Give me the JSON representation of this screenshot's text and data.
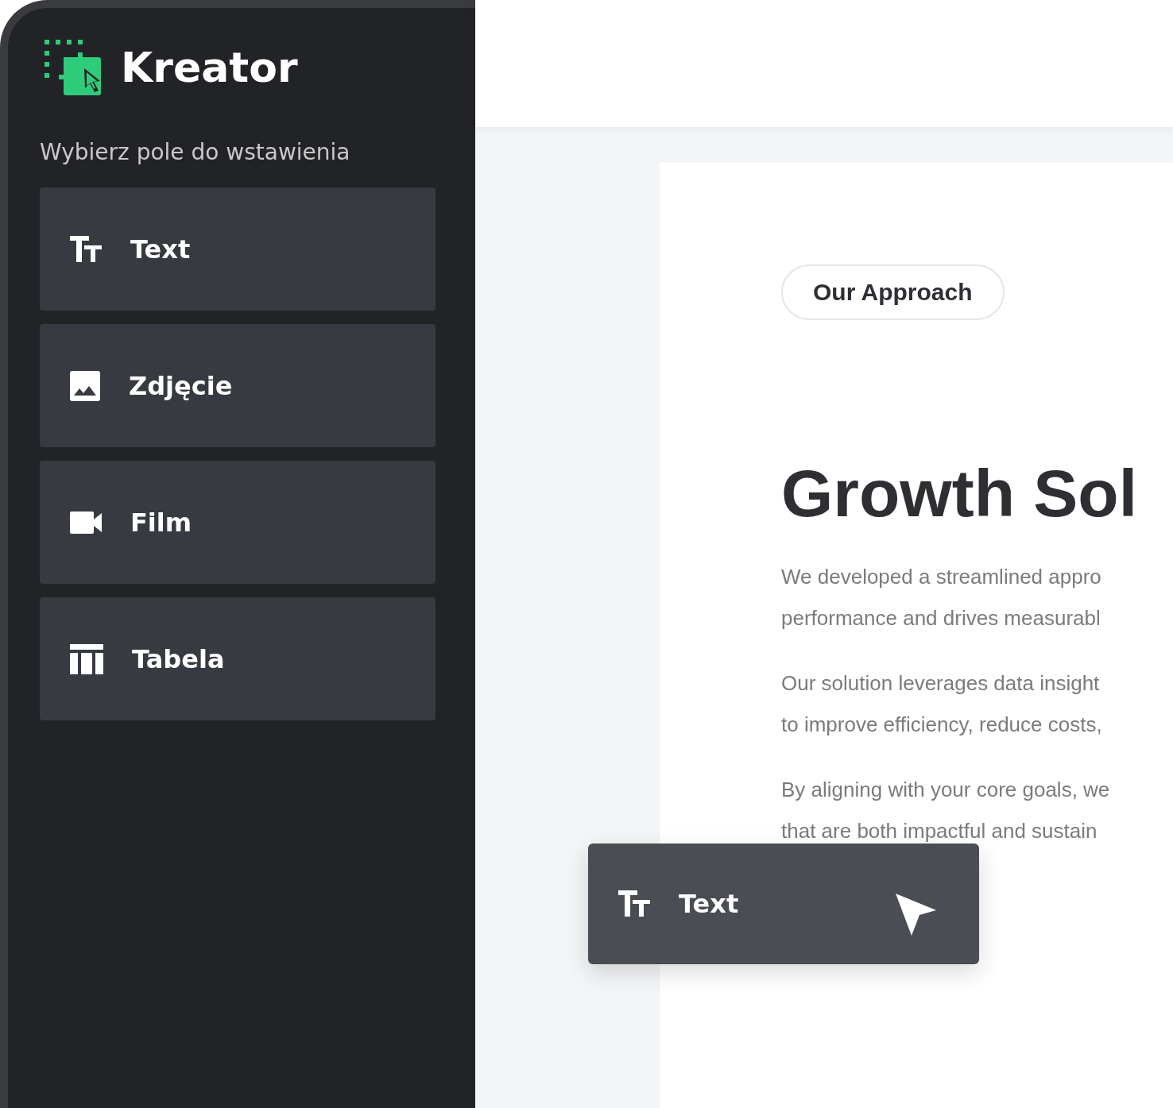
{
  "sidebar": {
    "logo": "Kreator",
    "subtitle": "Wybierz pole do wstawienia",
    "items": [
      {
        "kind": "text",
        "label": "Text"
      },
      {
        "kind": "image",
        "label": "Zdjęcie"
      },
      {
        "kind": "video",
        "label": "Film"
      },
      {
        "kind": "table",
        "label": "Tabela"
      }
    ]
  },
  "content": {
    "badge": "Our Approach",
    "heading": "Growth Sol",
    "paragraphs": [
      {
        "lines": [
          "We developed a streamlined appro",
          "performance and drives measurabl"
        ]
      },
      {
        "lines": [
          "Our solution leverages data insight",
          "to improve efficiency, reduce costs,"
        ]
      },
      {
        "lines": [
          "By aligning with your core goals, we",
          "that are both impactful and sustain"
        ]
      }
    ]
  },
  "drag_item": {
    "kind": "text",
    "label": "Text"
  }
}
